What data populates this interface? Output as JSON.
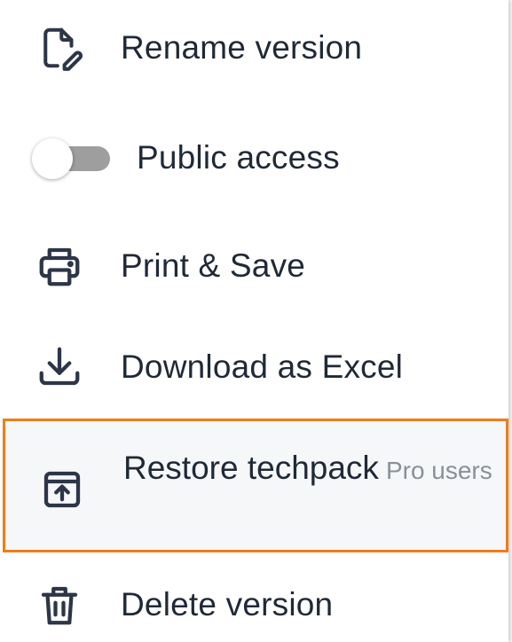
{
  "menu": {
    "items": [
      {
        "id": "rename",
        "label": "Rename version",
        "icon": "file-edit-icon"
      },
      {
        "id": "public",
        "label": "Public access",
        "icon": "toggle-switch",
        "toggle_on": false
      },
      {
        "id": "print",
        "label": "Print & Save",
        "icon": "printer-icon"
      },
      {
        "id": "download",
        "label": "Download as Excel",
        "icon": "download-icon"
      },
      {
        "id": "restore",
        "label": "Restore techpack",
        "badge": "Pro users",
        "icon": "archive-upload-icon",
        "highlighted": true
      },
      {
        "id": "delete",
        "label": "Delete version",
        "icon": "trash-icon"
      }
    ],
    "colors": {
      "text": "#1f2937",
      "icon": "#2d3648",
      "highlight_border": "#f07c1a",
      "highlight_bg": "#f6f7f9",
      "badge_text": "#8a8f98",
      "toggle_track": "#9e9e9e"
    }
  }
}
